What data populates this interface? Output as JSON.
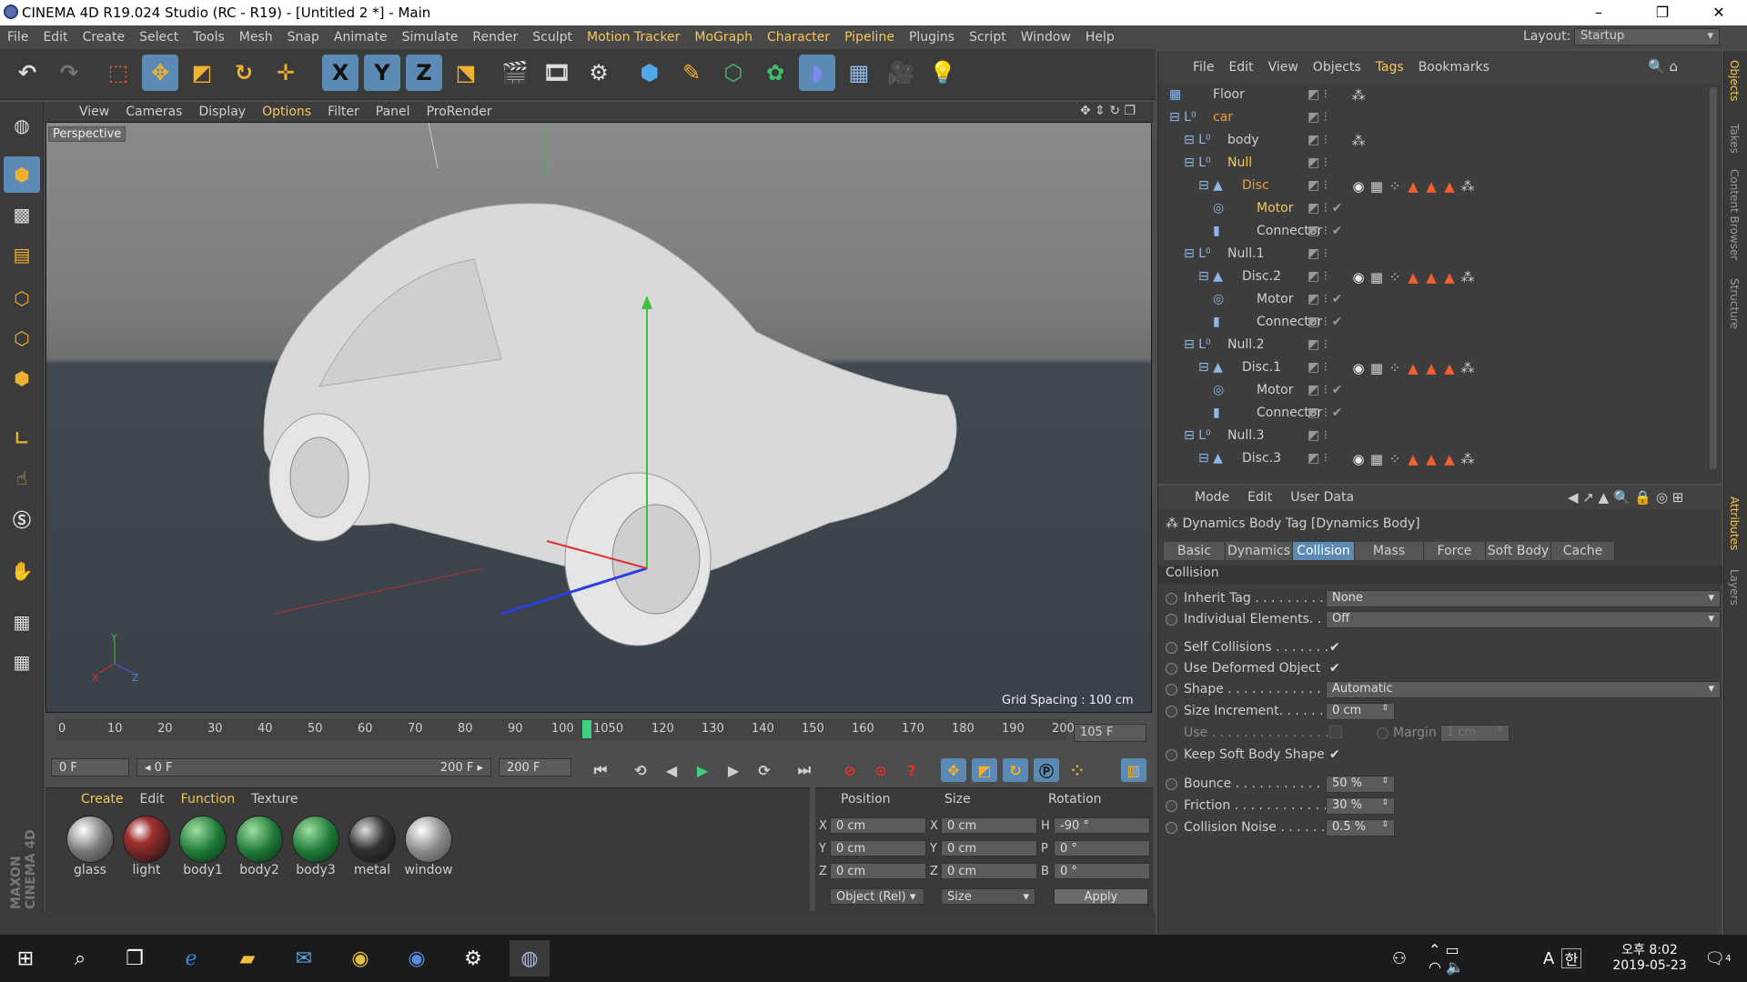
{
  "window": {
    "title": "CINEMA 4D R19.024 Studio (RC - R19) - [Untitled 2 *] - Main",
    "min": "–",
    "max": "❐",
    "close": "✕"
  },
  "menu": [
    "File",
    "Edit",
    "Create",
    "Select",
    "Tools",
    "Mesh",
    "Snap",
    "Animate",
    "Simulate",
    "Render",
    "Sculpt",
    "Motion Tracker",
    "MoGraph",
    "Character",
    "Pipeline",
    "Plugins",
    "Script",
    "Window",
    "Help"
  ],
  "layout": {
    "label": "Layout:",
    "value": "Startup"
  },
  "toolbar": {
    "x": "X",
    "y": "Y",
    "z": "Z"
  },
  "viewport": {
    "menu": [
      "View",
      "Cameras",
      "Display",
      "Options",
      "Filter",
      "Panel",
      "ProRender"
    ],
    "label": "Perspective",
    "grid_spacing": "Grid Spacing : 100 cm",
    "axis_y": "Y",
    "axis_x": "X",
    "axis_z": "Z"
  },
  "timeline": {
    "ticks": [
      "0",
      "10",
      "20",
      "30",
      "40",
      "50",
      "60",
      "70",
      "80",
      "90",
      "100",
      "1050",
      "120",
      "130",
      "140",
      "150",
      "160",
      "170",
      "180",
      "190",
      "200"
    ],
    "end_field": "105 F",
    "current": "0 F",
    "range_start": "◂ 0 F",
    "range_end": "200 F ▸",
    "max": "200 F"
  },
  "materials": {
    "menu": [
      "Create",
      "Edit",
      "Function",
      "Texture"
    ],
    "items": [
      "glass",
      "light",
      "body1",
      "body2",
      "body3",
      "metal",
      "window"
    ]
  },
  "coords": {
    "headers": [
      "Position",
      "Size",
      "Rotation"
    ],
    "rows": [
      {
        "axis": "X",
        "pos": "0 cm",
        "saxis": "X",
        "size": "0 cm",
        "raxis": "H",
        "rot": "-90 °"
      },
      {
        "axis": "Y",
        "pos": "0 cm",
        "saxis": "Y",
        "size": "0 cm",
        "raxis": "P",
        "rot": "0 °"
      },
      {
        "axis": "Z",
        "pos": "0 cm",
        "saxis": "Z",
        "size": "0 cm",
        "raxis": "B",
        "rot": "0 °"
      }
    ],
    "mode": "Object (Rel)",
    "size_mode": "Size",
    "apply": "Apply"
  },
  "objects": {
    "menu": [
      "File",
      "Edit",
      "View",
      "Objects",
      "Tags",
      "Bookmarks"
    ],
    "rows": [
      {
        "name": "Floor",
        "indent": 0,
        "color": "#cfcfcf"
      },
      {
        "name": "car",
        "indent": 0,
        "color": "#e8a040"
      },
      {
        "name": "body",
        "indent": 1,
        "color": "#cfcfcf"
      },
      {
        "name": "Null",
        "indent": 1,
        "color": "#f3c85a"
      },
      {
        "name": "Disc",
        "indent": 2,
        "color": "#e8a040"
      },
      {
        "name": "Motor",
        "indent": 3,
        "color": "#f3c85a"
      },
      {
        "name": "Connector",
        "indent": 3,
        "color": "#cfcfcf"
      },
      {
        "name": "Null.1",
        "indent": 1,
        "color": "#cfcfcf"
      },
      {
        "name": "Disc.2",
        "indent": 2,
        "color": "#cfcfcf"
      },
      {
        "name": "Motor",
        "indent": 3,
        "color": "#cfcfcf"
      },
      {
        "name": "Connector",
        "indent": 3,
        "color": "#cfcfcf"
      },
      {
        "name": "Null.2",
        "indent": 1,
        "color": "#cfcfcf"
      },
      {
        "name": "Disc.1",
        "indent": 2,
        "color": "#cfcfcf"
      },
      {
        "name": "Motor",
        "indent": 3,
        "color": "#cfcfcf"
      },
      {
        "name": "Connector",
        "indent": 3,
        "color": "#cfcfcf"
      },
      {
        "name": "Null.3",
        "indent": 1,
        "color": "#cfcfcf"
      },
      {
        "name": "Disc.3",
        "indent": 2,
        "color": "#cfcfcf"
      }
    ]
  },
  "attributes": {
    "menu": [
      "Mode",
      "Edit",
      "User Data"
    ],
    "title": "Dynamics Body Tag [Dynamics Body]",
    "tabs": [
      "Basic",
      "Dynamics",
      "Collision",
      "Mass",
      "Force",
      "Soft Body",
      "Cache"
    ],
    "section": "Collision",
    "inherit_tag": {
      "label": "Inherit Tag . . . . . . . . . . .",
      "value": "None"
    },
    "individual": {
      "label": "Individual Elements. . .",
      "value": "Off"
    },
    "self_collisions": "Self Collisions . . . . . . .",
    "use_deformed": "Use Deformed Object",
    "shape": {
      "label": "Shape . . . . . . . . . . . . . . . .",
      "value": "Automatic"
    },
    "size_increment": {
      "label": "Size Increment. . . . . . .",
      "value": "0 cm"
    },
    "use": "Use . . . . . . . . . . . . . . . .",
    "margin": {
      "label": "Margin",
      "value": "1 cm"
    },
    "keep_soft": "Keep Soft Body Shape",
    "bounce": {
      "label": "Bounce . . . . . . . . . . . . . .",
      "value": "50 %"
    },
    "friction": {
      "label": "Friction . . . . . . . . . . . . .",
      "value": "30 %"
    },
    "collision_noise": {
      "label": "Collision Noise . . . . . .",
      "value": "0.5 %"
    }
  },
  "right_tabs": [
    "Objects",
    "Takes",
    "Content Browser",
    "Structure",
    "Attributes",
    "Layers"
  ],
  "maxon": "MAXON CINEMA 4D",
  "taskbar": {
    "time_ampm": "오후 8:02",
    "date": "2019-05-23",
    "ime": "A",
    "hangul": "한",
    "notif": "4"
  },
  "colors": {
    "accent": "#5b8ab5",
    "highlight": "#f3c85a",
    "active_obj": "#e8a040"
  }
}
